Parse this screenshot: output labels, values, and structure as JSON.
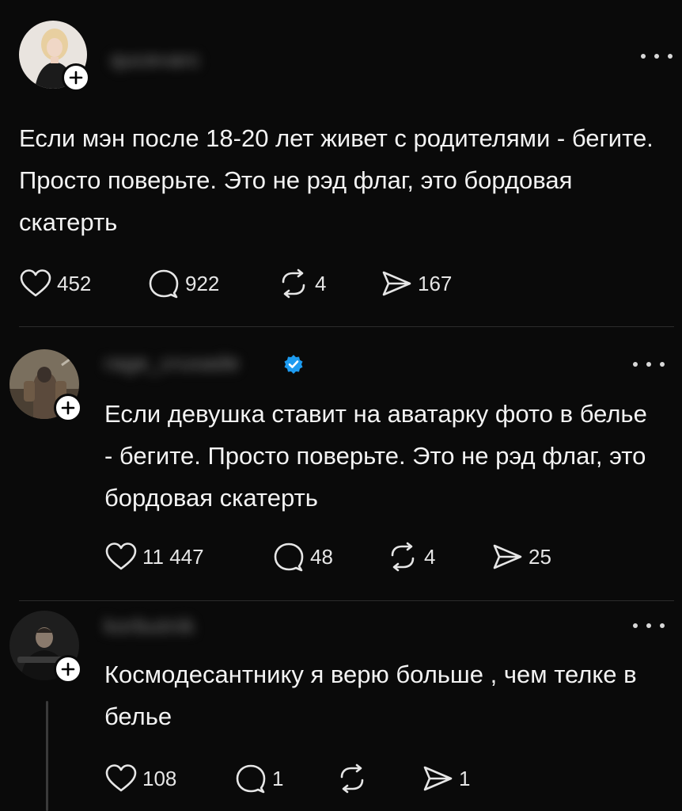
{
  "posts": [
    {
      "username": "qucevarc",
      "text": "Если мэн после 18-20 лет живет с родителями - бегите. Просто поверьте. Это не рэд флаг, это бордовая скатерть",
      "likes": "452",
      "replies": "922",
      "reposts": "4",
      "shares": "167"
    },
    {
      "username": "rage_crusade",
      "verified": true,
      "text": "Если девушка ставит на аватарку фото в белье - бегите. Просто поверьте. Это не рэд флаг, это бордовая скатерть",
      "likes": "11 447",
      "replies": "48",
      "reposts": "4",
      "shares": "25"
    },
    {
      "username": "korbutnik",
      "text": "Космодесантнику я верю больше , чем телке в белье",
      "likes": "108",
      "replies": "1",
      "reposts": "",
      "shares": "1"
    }
  ],
  "colors": {
    "background": "#0a0a0a",
    "text": "#f3f3f3",
    "verified_badge": "#1d9bf0"
  },
  "icons": [
    "plus-icon",
    "more-icon",
    "heart-icon",
    "comment-icon",
    "repost-icon",
    "share-icon",
    "verified-icon"
  ]
}
